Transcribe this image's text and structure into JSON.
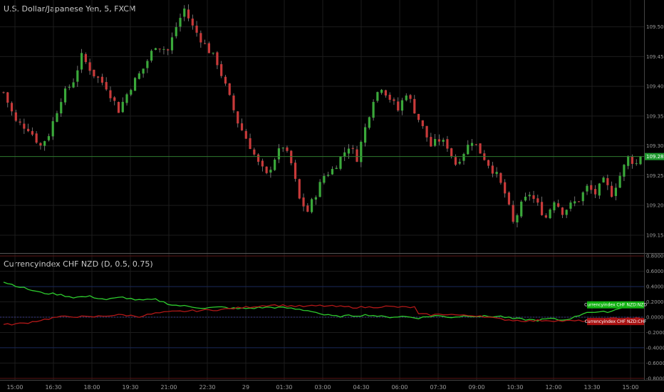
{
  "chart_data": [
    {
      "type": "candlestick",
      "title": "U.S. Dollar/Japanese Yen, 5, FXCM",
      "y_ticks": [
        "109.500",
        "109.450",
        "109.400",
        "109.350",
        "109.300",
        "109.250",
        "109.200",
        "109.150"
      ],
      "ylim": [
        109.12,
        109.545
      ],
      "current_price": 109.282,
      "current_price_label": "109.282",
      "x_labels": [
        "15:00",
        "16:30",
        "18:00",
        "19:30",
        "21:00",
        "22:30",
        "29",
        "01:30",
        "03:00",
        "04:30",
        "06:00",
        "07:30",
        "09:00",
        "10:30",
        "12:00",
        "13:30",
        "15:00"
      ],
      "close_path": [
        [
          0,
          109.39
        ],
        [
          3,
          109.34
        ],
        [
          6,
          109.33
        ],
        [
          9,
          109.3
        ],
        [
          11,
          109.32
        ],
        [
          14,
          109.38
        ],
        [
          17,
          109.41
        ],
        [
          19,
          109.45
        ],
        [
          22,
          109.42
        ],
        [
          25,
          109.4
        ],
        [
          28,
          109.36
        ],
        [
          31,
          109.4
        ],
        [
          34,
          109.43
        ],
        [
          37,
          109.47
        ],
        [
          40,
          109.46
        ],
        [
          42,
          109.5
        ],
        [
          44,
          109.53
        ],
        [
          46,
          109.5
        ],
        [
          48,
          109.48
        ],
        [
          50,
          109.46
        ],
        [
          52,
          109.44
        ],
        [
          54,
          109.4
        ],
        [
          57,
          109.34
        ],
        [
          60,
          109.3
        ],
        [
          62,
          109.27
        ],
        [
          64,
          109.25
        ],
        [
          66,
          109.28
        ],
        [
          68,
          109.3
        ],
        [
          70,
          109.27
        ],
        [
          72,
          109.21
        ],
        [
          74,
          109.19
        ],
        [
          76,
          109.22
        ],
        [
          78,
          109.25
        ],
        [
          80,
          109.26
        ],
        [
          82,
          109.28
        ],
        [
          84,
          109.3
        ],
        [
          86,
          109.28
        ],
        [
          88,
          109.33
        ],
        [
          90,
          109.38
        ],
        [
          92,
          109.4
        ],
        [
          94,
          109.38
        ],
        [
          96,
          109.36
        ],
        [
          98,
          109.39
        ],
        [
          100,
          109.36
        ],
        [
          102,
          109.33
        ],
        [
          104,
          109.3
        ],
        [
          106,
          109.31
        ],
        [
          108,
          109.3
        ],
        [
          110,
          109.27
        ],
        [
          112,
          109.29
        ],
        [
          114,
          109.31
        ],
        [
          116,
          109.29
        ],
        [
          118,
          109.27
        ],
        [
          120,
          109.25
        ],
        [
          122,
          109.22
        ],
        [
          124,
          109.17
        ],
        [
          126,
          109.2
        ],
        [
          128,
          109.22
        ],
        [
          130,
          109.2
        ],
        [
          132,
          109.18
        ],
        [
          134,
          109.21
        ],
        [
          136,
          109.19
        ],
        [
          138,
          109.2
        ],
        [
          140,
          109.21
        ],
        [
          142,
          109.23
        ],
        [
          144,
          109.22
        ],
        [
          146,
          109.24
        ],
        [
          148,
          109.22
        ],
        [
          150,
          109.25
        ],
        [
          152,
          109.28
        ],
        [
          154,
          109.27
        ],
        [
          155,
          109.285
        ]
      ]
    },
    {
      "type": "line",
      "title": "Currencyindex CHF NZD (D, 0.5, 0.75)",
      "y_ticks": [
        "0.8000",
        "0.6000",
        "0.4000",
        "0.2000",
        "0.0000",
        "-0.2000",
        "-0.4000",
        "-0.6000",
        "-0.8000"
      ],
      "ylim": [
        -0.82,
        0.82
      ],
      "series": [
        {
          "name": "Currencyindex CHF NZD:NZD",
          "color": "#2ecc2e",
          "points": [
            [
              0,
              0.46
            ],
            [
              5,
              0.38
            ],
            [
              9,
              0.32
            ],
            [
              13,
              0.3
            ],
            [
              17,
              0.26
            ],
            [
              21,
              0.27
            ],
            [
              25,
              0.23
            ],
            [
              29,
              0.26
            ],
            [
              33,
              0.22
            ],
            [
              37,
              0.23
            ],
            [
              41,
              0.16
            ],
            [
              45,
              0.14
            ],
            [
              49,
              0.12
            ],
            [
              53,
              0.13
            ],
            [
              57,
              0.11
            ],
            [
              61,
              0.12
            ],
            [
              65,
              0.13
            ],
            [
              69,
              0.12
            ],
            [
              72,
              0.1
            ],
            [
              75,
              0.08
            ],
            [
              78,
              0.03
            ],
            [
              81,
              0.01
            ],
            [
              85,
              0.02
            ],
            [
              89,
              0.03
            ],
            [
              93,
              0.0
            ],
            [
              97,
              0.01
            ],
            [
              101,
              -0.01
            ],
            [
              105,
              0.02
            ],
            [
              109,
              0.0
            ],
            [
              113,
              0.02
            ],
            [
              117,
              0.01
            ],
            [
              121,
              0.01
            ],
            [
              124,
              -0.02
            ],
            [
              127,
              -0.03
            ],
            [
              130,
              -0.04
            ],
            [
              133,
              -0.02
            ],
            [
              136,
              -0.04
            ],
            [
              139,
              0.0
            ],
            [
              142,
              0.07
            ],
            [
              145,
              0.06
            ],
            [
              148,
              0.08
            ],
            [
              151,
              0.14
            ],
            [
              153,
              0.17
            ],
            [
              155,
              0.18
            ]
          ]
        },
        {
          "name": "Currencyindex CHF NZD:CHF",
          "color": "#b21818",
          "points": [
            [
              0,
              -0.1
            ],
            [
              5,
              -0.08
            ],
            [
              9,
              -0.04
            ],
            [
              13,
              0.0
            ],
            [
              17,
              0.01
            ],
            [
              21,
              0.0
            ],
            [
              25,
              0.02
            ],
            [
              29,
              0.03
            ],
            [
              33,
              0.01
            ],
            [
              37,
              0.05
            ],
            [
              41,
              0.07
            ],
            [
              45,
              0.08
            ],
            [
              49,
              0.09
            ],
            [
              53,
              0.1
            ],
            [
              57,
              0.12
            ],
            [
              61,
              0.14
            ],
            [
              65,
              0.16
            ],
            [
              69,
              0.15
            ],
            [
              73,
              0.14
            ],
            [
              77,
              0.15
            ],
            [
              81,
              0.14
            ],
            [
              85,
              0.13
            ],
            [
              89,
              0.13
            ],
            [
              93,
              0.14
            ],
            [
              97,
              0.13
            ],
            [
              100,
              0.13
            ],
            [
              100.5,
              0.04
            ],
            [
              104,
              0.03
            ],
            [
              108,
              0.04
            ],
            [
              112,
              0.02
            ],
            [
              116,
              0.02
            ],
            [
              120,
              -0.02
            ],
            [
              124,
              -0.04
            ],
            [
              128,
              -0.05
            ],
            [
              132,
              -0.04
            ],
            [
              136,
              -0.05
            ],
            [
              140,
              -0.05
            ],
            [
              144,
              -0.04
            ],
            [
              148,
              -0.02
            ],
            [
              152,
              -0.01
            ],
            [
              155,
              -0.02
            ]
          ]
        }
      ]
    }
  ]
}
